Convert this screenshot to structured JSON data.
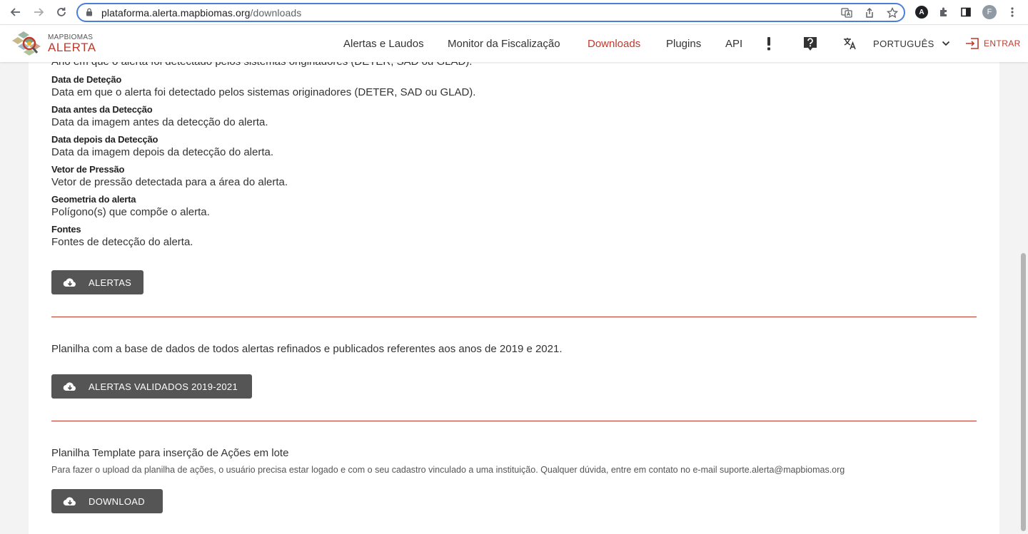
{
  "browser": {
    "url_host": "plataforma.alerta.mapbiomas.org",
    "url_path": "/downloads",
    "profile_initial": "F",
    "ext_initial": "A"
  },
  "header": {
    "logo_small": "MAPBIOMAS",
    "logo_big": "ALERTA",
    "nav": [
      "Alertas e Laudos",
      "Monitor da Fiscalização",
      "Downloads",
      "Plugins",
      "API"
    ],
    "language": "PORTUGUÊS",
    "login": "ENTRAR",
    "accent_color": "#c0392b"
  },
  "content": {
    "clipped_line": "Ano em que o alerta foi detectado pelos sistemas originadores (DETER, SAD ou GLAD).",
    "fields": [
      {
        "name": "Data de Deteção",
        "desc": "Data em que o alerta foi detectado pelos sistemas originadores (DETER, SAD ou GLAD)."
      },
      {
        "name": "Data antes da Detecção",
        "desc": "Data da imagem antes da detecção do alerta."
      },
      {
        "name": "Data depois da Detecção",
        "desc": "Data da imagem depois da detecção do alerta."
      },
      {
        "name": "Vetor de Pressão",
        "desc": "Vetor de pressão detectada para a área do alerta."
      },
      {
        "name": "Geometria do alerta",
        "desc": "Polígono(s) que compõe o alerta."
      },
      {
        "name": "Fontes",
        "desc": "Fontes de detecção do alerta."
      }
    ],
    "btn_alertas": "ALERTAS",
    "validated_text": "Planilha com a base de dados de todos alertas refinados e publicados referentes aos anos de 2019 e 2021.",
    "btn_validated": "ALERTAS VALIDADOS 2019-2021",
    "template_title": "Planilha Template para inserção de Ações em lote",
    "template_note": "Para fazer o upload da planilha de ações, o usuário precisa estar logado e com o seu cadastro vinculado a uma instituição. Qualquer dúvida, entre em contato no e-mail suporte.alerta@mapbiomas.org",
    "btn_download": "DOWNLOAD"
  }
}
